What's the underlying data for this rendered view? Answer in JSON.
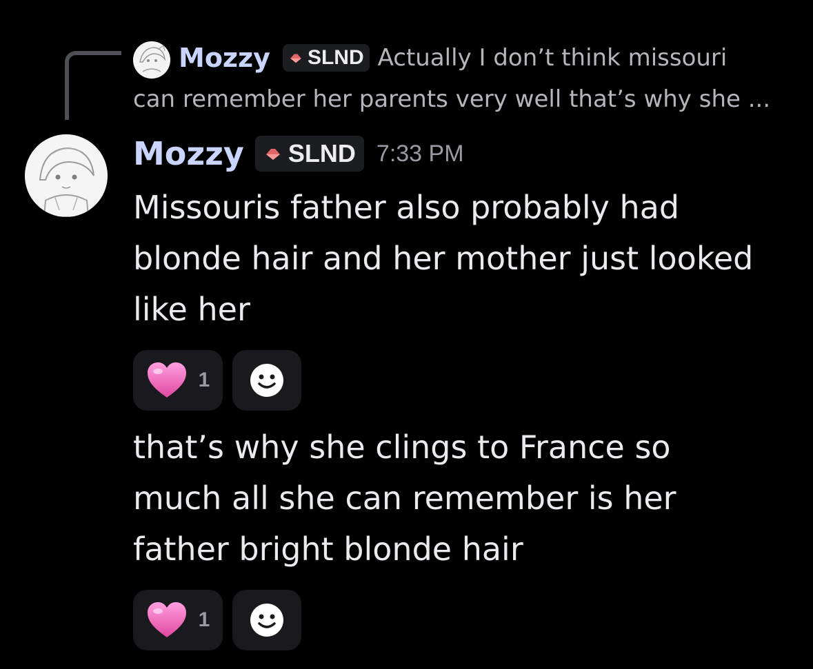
{
  "reply": {
    "author": "Mozzy",
    "tag": "SLND",
    "preview_line1": "Actually I don’t think missouri",
    "preview_line2": "can remember her parents very well that’s why she ..."
  },
  "message": {
    "author": "Mozzy",
    "tag": "SLND",
    "timestamp": "7:33 PM",
    "lines": [
      "Missouris father also probably had",
      "blonde hair and her mother just looked",
      "like her"
    ],
    "reaction": {
      "emoji": "heart-icon",
      "count": "1"
    }
  },
  "followup": {
    "lines": [
      "that’s why she clings to France so",
      "much all she can remember is her",
      "father bright blonde hair"
    ],
    "reaction": {
      "emoji": "heart-icon",
      "count": "1"
    }
  },
  "colors": {
    "background": "#000000",
    "username": "#c9d4ff",
    "text": "#ebebef",
    "muted": "#9a9aa2",
    "tag_bg": "#1c1d21",
    "reaction_bg": "#1a1a1e",
    "reply_line": "#4e5058",
    "heart": "#f17ccc",
    "tag_icon": "#e06565"
  }
}
